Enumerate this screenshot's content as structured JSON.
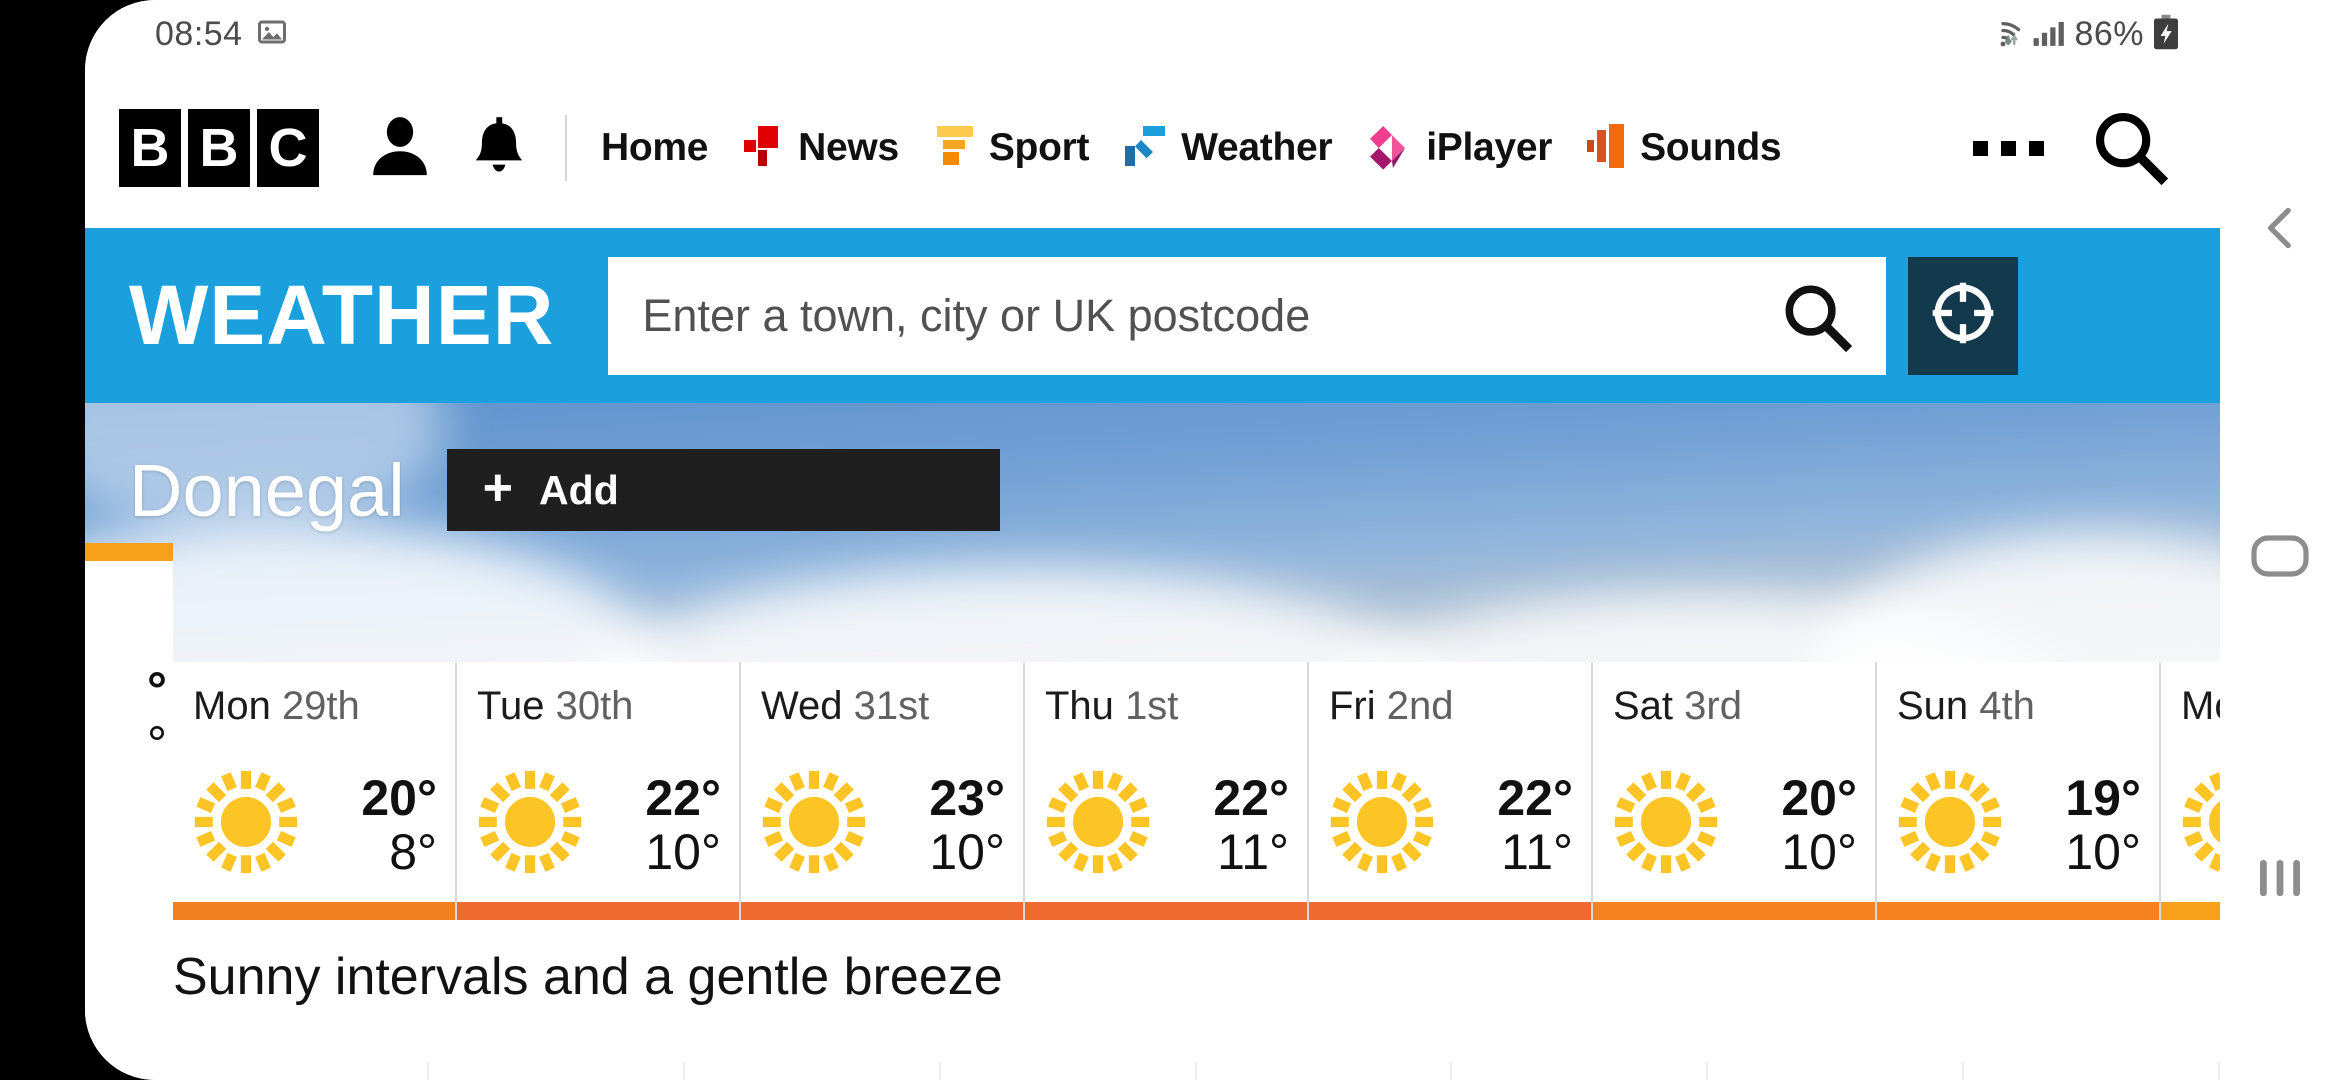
{
  "status_bar": {
    "time": "08:54",
    "screenshot_icon": "image-icon",
    "wifi_icon": "wifi-icon",
    "signal_icon": "cellular-signal-icon",
    "battery_percent": "86%",
    "battery_icon": "battery-charging-icon"
  },
  "masthead": {
    "logo_letters": [
      "B",
      "B",
      "C"
    ],
    "account_icon": "account-icon",
    "notifications_icon": "bell-icon",
    "nav_items": [
      {
        "label": "Home",
        "icon": "none"
      },
      {
        "label": "News",
        "icon": "bbc-news-logo"
      },
      {
        "label": "Sport",
        "icon": "bbc-sport-logo"
      },
      {
        "label": "Weather",
        "icon": "bbc-weather-logo"
      },
      {
        "label": "iPlayer",
        "icon": "bbc-iplayer-logo"
      },
      {
        "label": "Sounds",
        "icon": "bbc-sounds-logo"
      }
    ],
    "more_label": "More menu",
    "more_icon": "ellipsis-icon",
    "search_icon": "search-icon"
  },
  "weather_bar": {
    "wordmark": "WEATHER",
    "search_placeholder": "Enter a town, city or UK postcode",
    "search_value": "",
    "search_icon": "search-icon",
    "geolocation_icon": "crosshair-icon",
    "bar_color": "#1ba0dd",
    "geo_button_color": "#13394d"
  },
  "location": {
    "name": "Donegal",
    "add_label": "Add",
    "add_plus": "+"
  },
  "forecast": {
    "days": [
      {
        "day": "Mon",
        "date": "29th",
        "icon": "sunny-icon",
        "max": "20°",
        "min": "8°",
        "bar_color": "#f08020"
      },
      {
        "day": "Tue",
        "date": "30th",
        "icon": "sunny-icon",
        "max": "22°",
        "min": "10°",
        "bar_color": "#ee6a2e"
      },
      {
        "day": "Wed",
        "date": "31st",
        "icon": "sunny-icon",
        "max": "23°",
        "min": "10°",
        "bar_color": "#ee6a2e"
      },
      {
        "day": "Thu",
        "date": "1st",
        "icon": "sunny-icon",
        "max": "22°",
        "min": "11°",
        "bar_color": "#ee6a2e"
      },
      {
        "day": "Fri",
        "date": "2nd",
        "icon": "sunny-icon",
        "max": "22°",
        "min": "11°",
        "bar_color": "#ee6a2e"
      },
      {
        "day": "Sat",
        "date": "3rd",
        "icon": "sunny-icon",
        "max": "20°",
        "min": "10°",
        "bar_color": "#f5821f"
      },
      {
        "day": "Sun",
        "date": "4th",
        "icon": "sunny-icon",
        "max": "19°",
        "min": "10°",
        "bar_color": "#f5821f"
      },
      {
        "day": "Mon",
        "date": "",
        "icon": "sunny-icon",
        "max": "",
        "min": "",
        "bar_color": "#f9a01b"
      }
    ],
    "edge_column": {
      "max": "°",
      "min": "°",
      "bar_color": "#f9a01b"
    }
  },
  "summary": {
    "text": "Sunny intervals and a gentle breeze"
  },
  "android_nav": {
    "back_icon": "chevron-left-icon",
    "home_icon": "home-rounded-rect-icon",
    "recents_icon": "recent-apps-icon"
  }
}
